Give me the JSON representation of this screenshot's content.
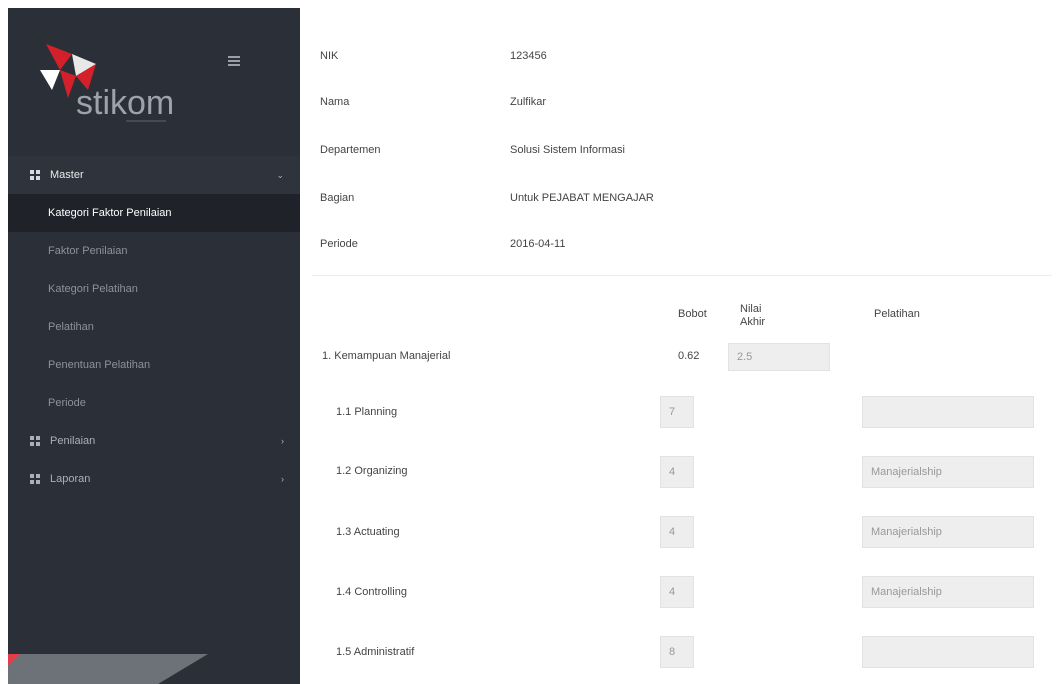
{
  "sidebar": {
    "logo_text": "stikom",
    "menu": [
      {
        "label": "Master",
        "expanded": true,
        "items": [
          {
            "label": "Kategori Faktor Penilaian",
            "active": true
          },
          {
            "label": "Faktor Penilaian",
            "active": false
          },
          {
            "label": "Kategori Pelatihan",
            "active": false
          },
          {
            "label": "Pelatihan",
            "active": false
          },
          {
            "label": "Penentuan Pelatihan",
            "active": false
          },
          {
            "label": "Periode",
            "active": false
          }
        ]
      },
      {
        "label": "Penilaian",
        "expanded": false
      },
      {
        "label": "Laporan",
        "expanded": false
      }
    ]
  },
  "info": {
    "nik_label": "NIK",
    "nik_value": "123456",
    "nama_label": "Nama",
    "nama_value": "Zulfikar",
    "departemen_label": "Departemen",
    "departemen_value": "Solusi Sistem Informasi",
    "bagian_label": "Bagian",
    "bagian_value": "Untuk PEJABAT MENGAJAR",
    "periode_label": "Periode",
    "periode_value": "2016-04-11"
  },
  "table": {
    "headers": {
      "bobot": "Bobot",
      "nilai_line1": "Nilai",
      "nilai_line2": "Akhir",
      "pelatihan": "Pelatihan"
    },
    "category": {
      "label": "1. Kemampuan Manajerial",
      "bobot": "0.62",
      "nilai_akhir": "2.5"
    },
    "rows": [
      {
        "label": "1.1 Planning",
        "value": "7",
        "pelatihan": ""
      },
      {
        "label": "1.2 Organizing",
        "value": "4",
        "pelatihan": "Manajerialship"
      },
      {
        "label": "1.3 Actuating",
        "value": "4",
        "pelatihan": "Manajerialship"
      },
      {
        "label": "1.4 Controlling",
        "value": "4",
        "pelatihan": "Manajerialship"
      },
      {
        "label": "1.5 Administratif",
        "value": "8",
        "pelatihan": ""
      }
    ]
  },
  "colors": {
    "sidebar_bg": "#2b3038",
    "active_bg": "#1f2329",
    "input_bg": "#eeeeee"
  },
  "icons": {
    "menu_toggle": "hamburger-icon",
    "group": "grid-icon",
    "expanded": "chevron-down-icon",
    "collapsed": "chevron-right-icon",
    "logo": "stikom-logo-icon"
  }
}
